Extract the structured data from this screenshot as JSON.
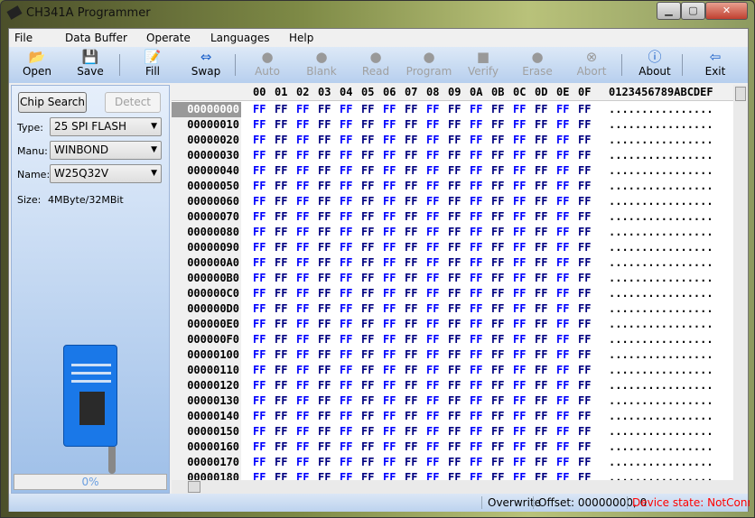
{
  "window": {
    "title": "CH341A Programmer"
  },
  "menu": [
    "File",
    "Data Buffer",
    "Operate",
    "Languages",
    "Help"
  ],
  "toolbar": [
    {
      "label": "Open",
      "icon": "folder-open-icon",
      "enabled": true
    },
    {
      "label": "Save",
      "icon": "floppy-disk-icon",
      "enabled": true
    },
    {
      "label": "Fill",
      "icon": "fill-edit-icon",
      "enabled": true
    },
    {
      "label": "Swap",
      "icon": "swap-arrows-icon",
      "enabled": true
    },
    {
      "label": "Auto",
      "icon": "auto-icon",
      "enabled": false
    },
    {
      "label": "Blank",
      "icon": "blank-check-icon",
      "enabled": false
    },
    {
      "label": "Read",
      "icon": "read-icon",
      "enabled": false
    },
    {
      "label": "Program",
      "icon": "program-icon",
      "enabled": false
    },
    {
      "label": "Verify",
      "icon": "verify-icon",
      "enabled": false
    },
    {
      "label": "Erase",
      "icon": "erase-icon",
      "enabled": false
    },
    {
      "label": "Abort",
      "icon": "abort-icon",
      "enabled": false
    },
    {
      "label": "About",
      "icon": "info-icon",
      "enabled": true
    },
    {
      "label": "Exit",
      "icon": "exit-door-icon",
      "enabled": true
    }
  ],
  "panel": {
    "chip_search": "Chip Search",
    "detect": "Detect",
    "type_label": "Type:",
    "type_value": "25 SPI FLASH",
    "manu_label": "Manu:",
    "manu_value": "WINBOND",
    "name_label": "Name:",
    "name_value": "W25Q32V",
    "size_label": "Size:",
    "size_value": "4MByte/32MBit",
    "progress": "0%"
  },
  "hex": {
    "columns": [
      "00",
      "01",
      "02",
      "03",
      "04",
      "05",
      "06",
      "07",
      "08",
      "09",
      "0A",
      "0B",
      "0C",
      "0D",
      "0E",
      "0F"
    ],
    "ascii_header": "0123456789ABCDEF",
    "addresses": [
      "00000000",
      "00000010",
      "00000020",
      "00000030",
      "00000040",
      "00000050",
      "00000060",
      "00000070",
      "00000080",
      "00000090",
      "000000A0",
      "000000B0",
      "000000C0",
      "000000D0",
      "000000E0",
      "000000F0",
      "00000100",
      "00000110",
      "00000120",
      "00000130",
      "00000140",
      "00000150",
      "00000160",
      "00000170",
      "00000180"
    ],
    "byte_value": "FF",
    "ascii_value": "................",
    "colors": {
      "even": "#0000ff",
      "odd": "#000080"
    }
  },
  "status": {
    "mode": "Overwrite",
    "offset": "Offset: 00000000, 0",
    "device": "Device state: NotConnect..",
    "device_color": "#ff0000"
  }
}
